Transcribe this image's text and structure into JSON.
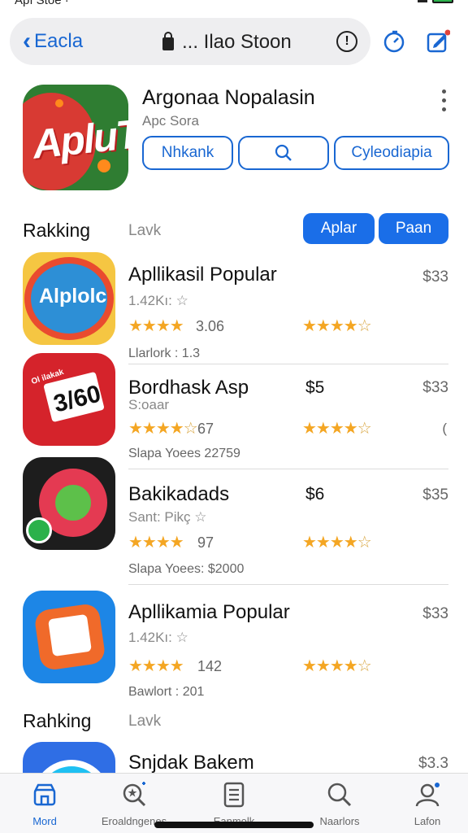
{
  "status": {
    "left": "Apı Stoe ·"
  },
  "nav": {
    "back_label": "Eacla",
    "address": "... Ilao Stoon",
    "info_symbol": "!"
  },
  "app": {
    "title": "Argonaa Nopalasin",
    "subtitle": "Apc Sora",
    "icon_text": "ApluT",
    "buttons": [
      "Nhkank",
      "Cyleodiapia"
    ]
  },
  "section1": {
    "title": "Rakking",
    "link": "Lavk",
    "filter_buttons": [
      "Aplar",
      "Paan"
    ]
  },
  "rows": [
    {
      "name": "Apllikasil Popular",
      "price": "$33",
      "sub": "1.42Kı: ☆",
      "rating_left": "3.06",
      "foot": "Llarlork : 1.3",
      "icon_text": "Alplolc"
    },
    {
      "name": "Bordhask Asp",
      "mid_price": "$5",
      "price": "$33",
      "sub": "S:oaar",
      "rating_left": "67",
      "foot": "Slapa Yoees 22759",
      "end": "(",
      "icon_text": "3/60",
      "tag": "Ol ilakak"
    },
    {
      "name": "Bakikadads",
      "mid_price": "$6",
      "price": "$35",
      "sub": "Sant: Pikç ☆",
      "rating_left": "97",
      "foot": "Slapa Yoees: $2000"
    },
    {
      "name": "Apllikamia Popular",
      "price": "$33",
      "sub": "1.42Kı: ☆",
      "rating_left": "142",
      "foot": "Bawlort : 201"
    }
  ],
  "section2": {
    "title": "Rahking",
    "link": "Lavk"
  },
  "partial_row": {
    "name": "Snjdak Bakem",
    "price": "$3.3"
  },
  "tabs": [
    {
      "label": "Mord",
      "icon": "store-icon"
    },
    {
      "label": "Eroaldngenes",
      "icon": "search-star-icon"
    },
    {
      "label": "Eanmolk",
      "icon": "list-doc-icon"
    },
    {
      "label": "Naarlors",
      "icon": "search-icon"
    },
    {
      "label": "Lafon",
      "icon": "person-icon"
    }
  ],
  "colors": {
    "accent": "#1967d2",
    "button_fill": "#1a6ee8",
    "star": "#f4a623"
  }
}
